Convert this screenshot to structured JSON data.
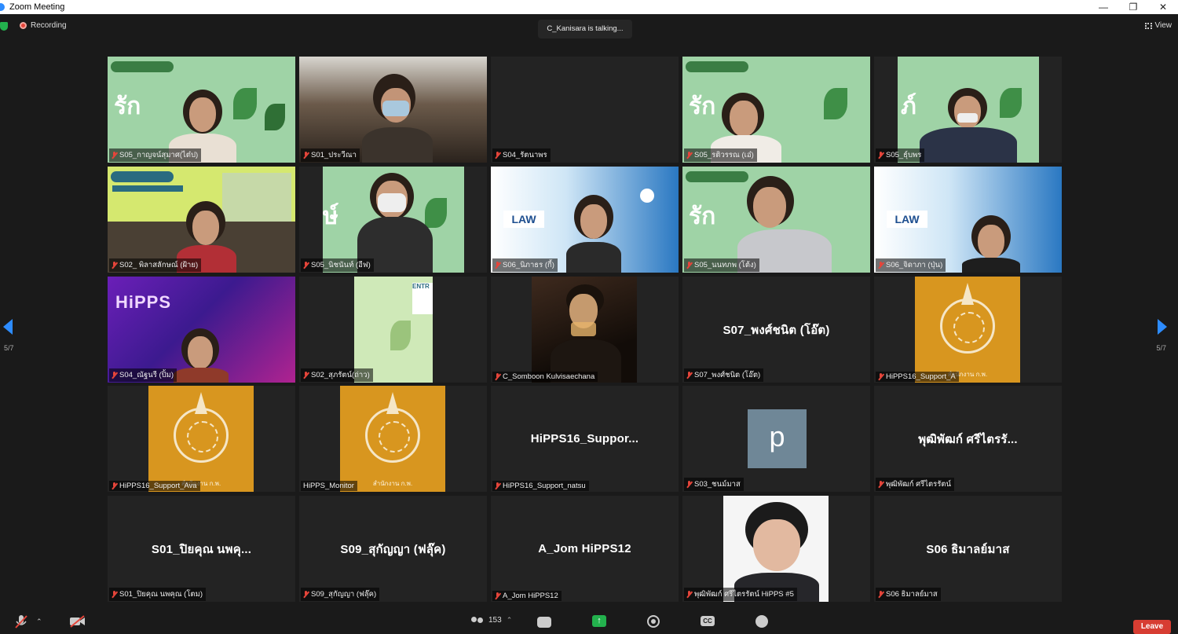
{
  "window": {
    "title": "Zoom Meeting"
  },
  "top": {
    "recording": "Recording",
    "talking": "C_Kanisara is talking...",
    "view": "View"
  },
  "page": {
    "left": "5/7",
    "right": "5/7"
  },
  "colors": {
    "accent": "#2d8cff",
    "leave": "#d73d32",
    "emblem": "#d8961f",
    "mute": "#e5453a"
  },
  "tiles": [
    {
      "label": "S05_กาญจน์สุมาศ(ไต๋ป)"
    },
    {
      "label": "S01_ประวีณา"
    },
    {
      "label": "S04_รัตนาพร"
    },
    {
      "label": "S05_รติวรรณ (เอ๋)"
    },
    {
      "label": "S05_ธุ์บพร"
    },
    {
      "label": "S02_ พิลาสลักษณ์ (ฝ้าย)"
    },
    {
      "label": "S05_นิชนันท์ (อีฟ)"
    },
    {
      "label": "S06_นิภาธร (กี้)"
    },
    {
      "label": "S05_นนทภพ (โต้ง)"
    },
    {
      "label": "S06_จิดาภา (ปุ่น)"
    },
    {
      "label": "S04_ณัฐนรี (ปิ้ม)"
    },
    {
      "label": "S02_สุภรัตน์(ถ่าว)"
    },
    {
      "label": "C_Somboon Kulvisaechana"
    },
    {
      "label": "S07_พงศ์ชนิต (โอ๊ต)",
      "name": "S07_พงศ์ชนิต (โอ๊ต)"
    },
    {
      "label": "HiPPS16_Support_A",
      "caption": "สำนักงาน ก.พ."
    },
    {
      "label": "HiPPS16_Support_Ava",
      "caption": "สำนักงาน ก.พ."
    },
    {
      "label": "HiPPS_Monitor",
      "caption": "สำนักงาน ก.พ."
    },
    {
      "label": "HiPPS16_Support_natsu",
      "name": "HiPPS16_Suppor..."
    },
    {
      "label": "S03_ชนม์มาส",
      "avatar": "p"
    },
    {
      "label": "พุฒิพัฒก์ ศรีไตรรัตน์",
      "name": "พุฒิพัฒก์ ศรีไตรรั..."
    },
    {
      "label": "S01_ปิยคุณ นพคุณ (โตม)",
      "name": "S01_ปิยคุณ นพคุ..."
    },
    {
      "label": "S09_สุกัญญา (ฟลุ๊ค)",
      "name": "S09_สุกัญญา (ฟลุ๊ค)"
    },
    {
      "label": "A_Jom HiPPS12",
      "name": "A_Jom HiPPS12"
    },
    {
      "label": "พุฒิพัฒก์ ศรีไตรรัตน์ HiPPS #5"
    },
    {
      "label": "S06 ธิมาลย์มาส",
      "name": "S06 ธิมาลย์มาส"
    }
  ],
  "toolbar": {
    "participants_count": "153",
    "leave": "Leave"
  }
}
